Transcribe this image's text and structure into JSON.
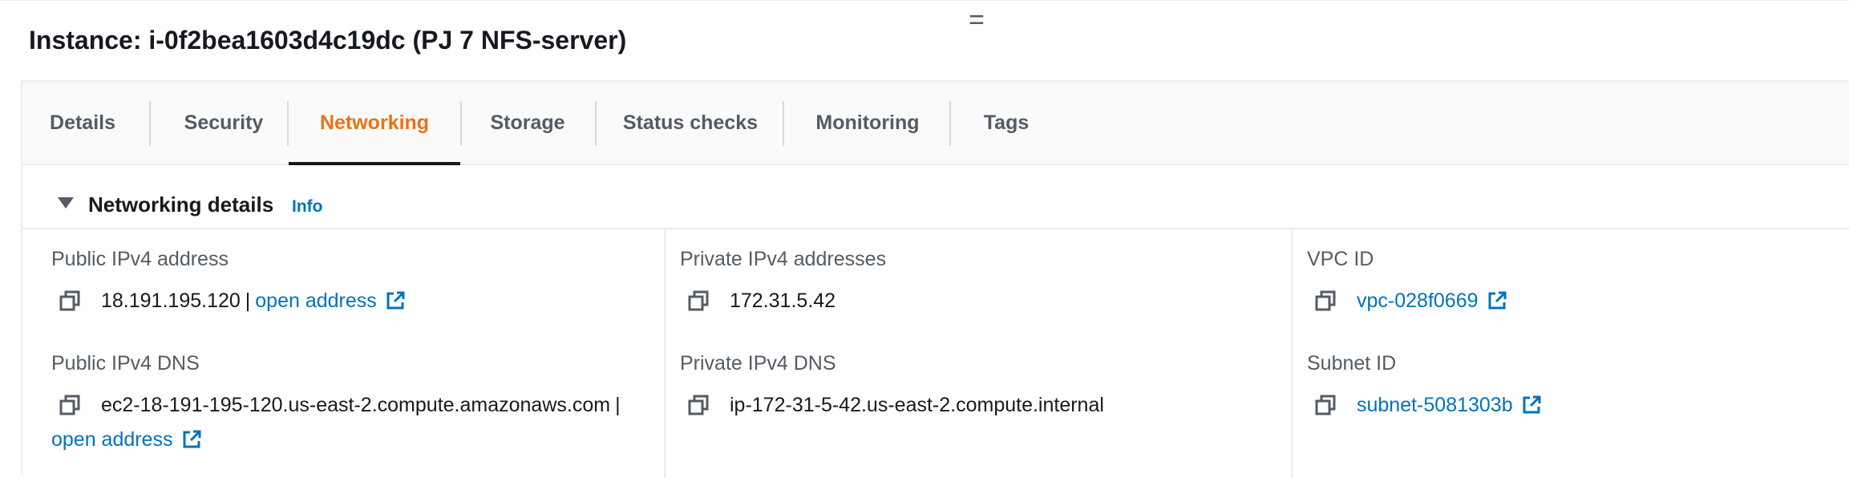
{
  "drag_handle": "=",
  "instance": {
    "title": "Instance: i-0f2bea1603d4c19dc (PJ 7 NFS-server)"
  },
  "tabs": [
    {
      "label": "Details",
      "active": false
    },
    {
      "label": "Security",
      "active": false
    },
    {
      "label": "Networking",
      "active": true
    },
    {
      "label": "Storage",
      "active": false
    },
    {
      "label": "Status checks",
      "active": false
    },
    {
      "label": "Monitoring",
      "active": false
    },
    {
      "label": "Tags",
      "active": false
    }
  ],
  "section": {
    "title": "Networking details",
    "info_label": "Info"
  },
  "fields": {
    "public_ipv4": {
      "label": "Public IPv4 address",
      "value": "18.191.195.120",
      "separator": "|",
      "link": "open address"
    },
    "public_dns": {
      "label": "Public IPv4 DNS",
      "value": "ec2-18-191-195-120.us-east-2.compute.amazonaws.com",
      "separator": "|",
      "link": "open address"
    },
    "private_ipv4": {
      "label": "Private IPv4 addresses",
      "value": "172.31.5.42"
    },
    "private_dns": {
      "label": "Private IPv4 DNS",
      "value": "ip-172-31-5-42.us-east-2.compute.internal"
    },
    "vpc_id": {
      "label": "VPC ID",
      "value": "vpc-028f0669"
    },
    "subnet_id": {
      "label": "Subnet ID",
      "value": "subnet-5081303b"
    }
  },
  "colors": {
    "active_tab": "#ec7211",
    "link": "#0073bb",
    "text": "#16191f",
    "muted": "#545b64"
  },
  "icons": {
    "copy": "copy-icon",
    "external": "external-link-icon",
    "caret": "caret-down-icon"
  }
}
